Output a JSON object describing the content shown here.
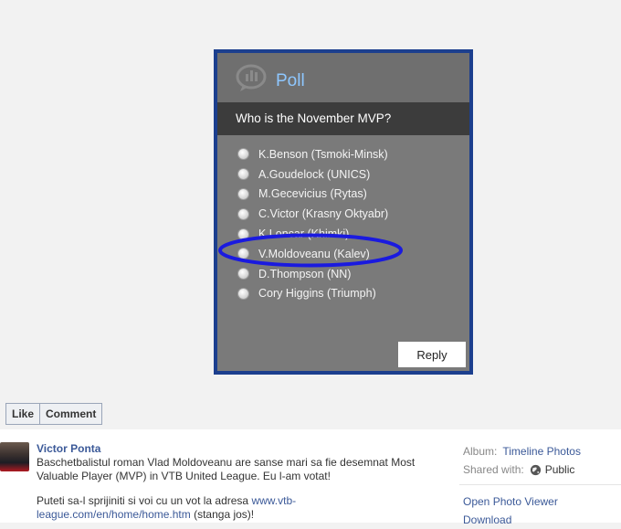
{
  "poll": {
    "title": "Poll",
    "question": "Who is the November MVP?",
    "options": [
      "K.Benson (Tsmoki-Minsk)",
      "A.Goudelock (UNICS)",
      "M.Gecevicius (Rytas)",
      "C.Victor (Krasny Oktyabr)",
      "K.Loncar (Khimki)",
      "V.Moldoveanu (Kalev)",
      "D.Thompson (NN)",
      "Cory Higgins (Triumph)"
    ],
    "highlighted_option": "V.Moldoveanu (Kalev)",
    "reply_label": "Reply",
    "icon": "chat-bubble-chart-icon",
    "colors": {
      "border": "#1c3f8e",
      "title": "#8ec7ff",
      "highlight_ellipse": "#1a1adf"
    }
  },
  "actions": {
    "like_label": "Like",
    "comment_label": "Comment"
  },
  "post": {
    "author": "Victor Ponta",
    "text_line1": "Baschetbalistul roman Vlad Moldoveanu are sanse mari sa fie desemnat Most Valuable Player (MVP) in VTB United League. Eu l-am votat!",
    "text2_prefix": "Puteti sa-l sprijiniti si voi cu un vot la adresa ",
    "text2_link": "www.vtb-league.com/en/home/home.htm",
    "text2_suffix": " (stanga jos)!"
  },
  "side": {
    "album_label": "Album:",
    "album_value": "Timeline Photos",
    "shared_label": "Shared with:",
    "shared_value": "Public",
    "shared_icon": "globe-icon",
    "open_viewer": "Open Photo Viewer",
    "download": "Download"
  }
}
